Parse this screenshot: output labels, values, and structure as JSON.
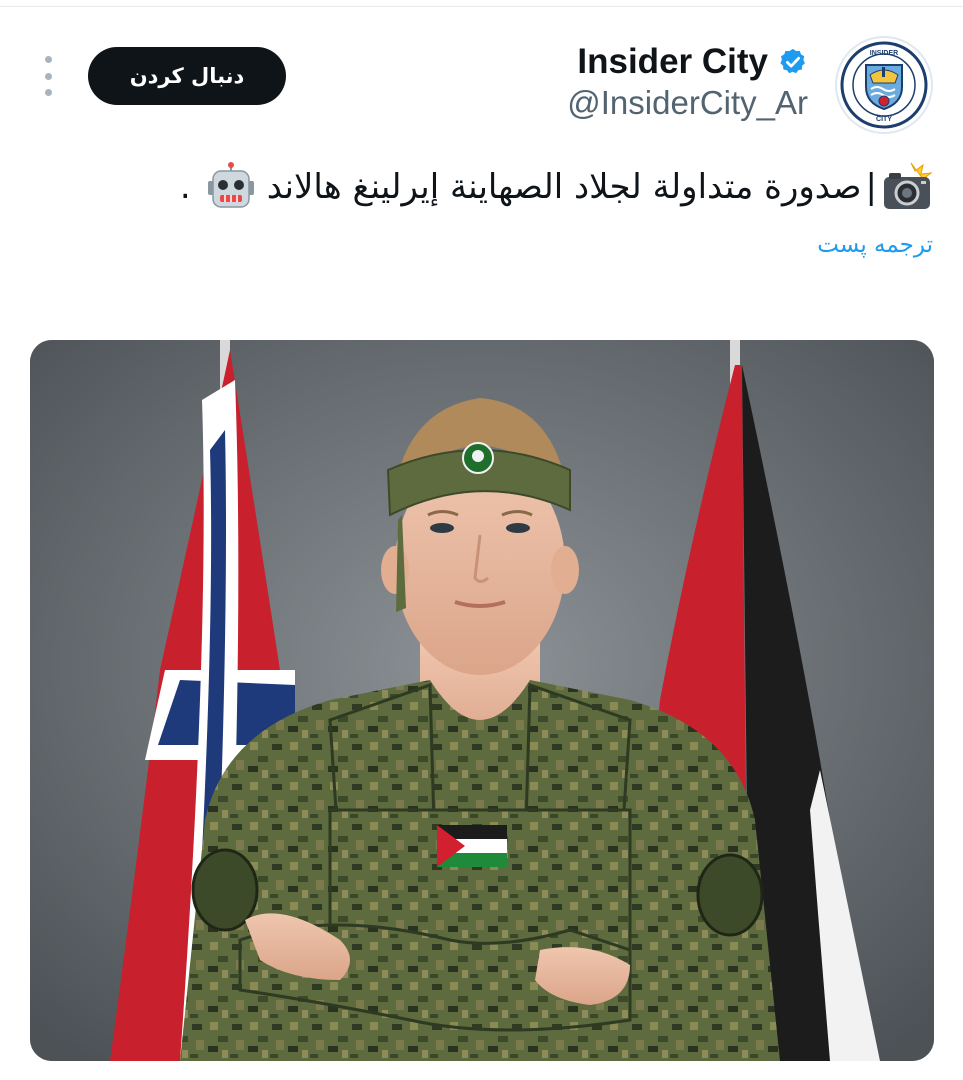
{
  "author": {
    "name": "Insider City",
    "handle": "@InsiderCity_Ar",
    "verified": true,
    "avatar": {
      "icon": "manchester-city-crest-icon",
      "text": "INSIDER CITY",
      "ring_color": "#1c3e6e",
      "accent_color": "#6cabdd"
    }
  },
  "actions": {
    "follow_label": "دنبال کردن",
    "more_icon": "more-vertical-icon"
  },
  "tweet": {
    "prefix_emoji": "camera-flash-icon",
    "separator": "|",
    "text": "صدورة متداولة لجلاد الصهاينة إيرلينغ هالاند",
    "suffix_emoji": "robot-face-icon",
    "trailing": "."
  },
  "translate_label": "ترجمه پست",
  "colors": {
    "text_primary": "#0f1419",
    "text_secondary": "#536471",
    "link": "#1d9bf0",
    "verified": "#1d9bf0",
    "button_bg": "#0f1419"
  }
}
